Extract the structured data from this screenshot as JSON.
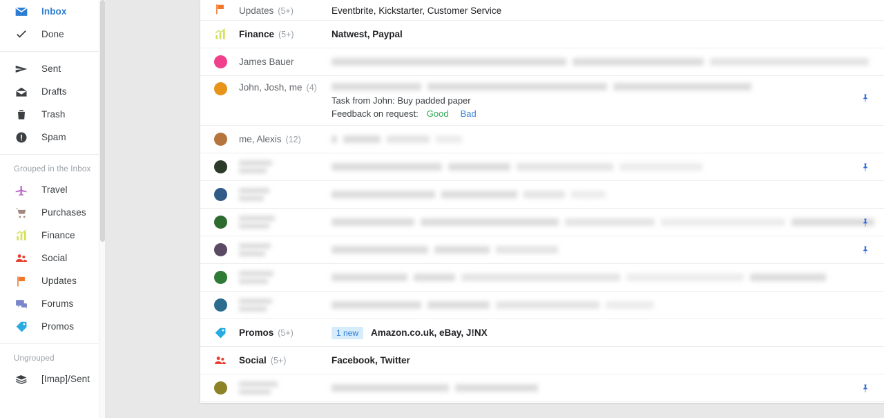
{
  "sidebar": {
    "primary": [
      {
        "label": "Inbox",
        "icon": "inbox-envelope-icon",
        "active": true
      },
      {
        "label": "Done",
        "icon": "check-icon",
        "active": false
      }
    ],
    "system": [
      {
        "label": "Sent",
        "icon": "send-paperplane-icon"
      },
      {
        "label": "Drafts",
        "icon": "draft-envelope-icon"
      },
      {
        "label": "Trash",
        "icon": "trash-icon"
      },
      {
        "label": "Spam",
        "icon": "spam-exclamation-icon"
      }
    ],
    "grouped_title": "Grouped in the Inbox",
    "grouped": [
      {
        "label": "Travel",
        "icon": "airplane-icon",
        "color": "#b968c7"
      },
      {
        "label": "Purchases",
        "icon": "cart-icon",
        "color": "#a1887f"
      },
      {
        "label": "Finance",
        "icon": "bar-chart-icon",
        "color": "#d4e157"
      },
      {
        "label": "Social",
        "icon": "people-icon",
        "color": "#e94235"
      },
      {
        "label": "Updates",
        "icon": "flag-icon",
        "color": "#f4762a"
      },
      {
        "label": "Forums",
        "icon": "forum-icon",
        "color": "#7986cb"
      },
      {
        "label": "Promos",
        "icon": "tag-icon",
        "color": "#29abe2"
      }
    ],
    "ungrouped_title": "Ungrouped",
    "ungrouped": [
      {
        "label": "[Imap]/Sent",
        "icon": "stacked-mail-icon"
      }
    ]
  },
  "list": {
    "rows": [
      {
        "id": "row-updates",
        "kind": "bundle",
        "icon": "flag-icon",
        "icon_color": "#f4762a",
        "name": "Updates",
        "count": "(5+)",
        "bold": false,
        "subject": "Eventbrite, Kickstarter, Customer Service",
        "subject_bold": false,
        "badge": "",
        "pinned": false,
        "clipped": true
      },
      {
        "id": "row-finance",
        "kind": "bundle",
        "icon": "bar-chart-icon",
        "icon_color": "#d4e157",
        "name": "Finance",
        "count": "(5+)",
        "bold": true,
        "subject": "Natwest, Paypal",
        "subject_bold": true,
        "badge": "",
        "pinned": false
      },
      {
        "id": "row-james-bauer",
        "kind": "message",
        "avatar_color": "#f0408c",
        "name": "James Bauer",
        "count": "",
        "bold": false,
        "subject": "",
        "redacted": [
          340,
          190,
          230
        ],
        "pinned": false
      },
      {
        "id": "row-john-josh-me",
        "kind": "task",
        "avatar_color": "#e8941a",
        "name": "John, Josh, me",
        "count": "(4)",
        "bold": false,
        "redacted": [
          130,
          260,
          200
        ],
        "task_text": "Task from John: Buy padded paper",
        "feedback_label": "Feedback on request:",
        "feedback_good": "Good",
        "feedback_bad": "Bad",
        "pinned": true
      },
      {
        "id": "row-me-alexis",
        "kind": "message",
        "avatar_color": "#b5753c",
        "name": "me, Alexis",
        "count": "(12)",
        "bold": false,
        "redacted": [
          8,
          54,
          62,
          38
        ],
        "pinned": false
      },
      {
        "id": "row-redacted-1",
        "kind": "redacted",
        "avatar_color": "#2c3a2a",
        "who_redacted": [
          48,
          40
        ],
        "redacted": [
          160,
          90,
          140,
          120
        ],
        "pinned": true
      },
      {
        "id": "row-redacted-2",
        "kind": "redacted",
        "avatar_color": "#2f5b86",
        "who_redacted": [
          44,
          36
        ],
        "redacted": [
          150,
          110,
          60,
          50
        ],
        "pinned": false
      },
      {
        "id": "row-redacted-3",
        "kind": "redacted",
        "avatar_color": "#2e6b2e",
        "who_redacted": [
          52,
          44
        ],
        "redacted": [
          120,
          200,
          130,
          180,
          120
        ],
        "pinned": true
      },
      {
        "id": "row-redacted-4",
        "kind": "redacted",
        "avatar_color": "#5b4a63",
        "who_redacted": [
          46,
          38
        ],
        "redacted": [
          140,
          80,
          90
        ],
        "pinned": true
      },
      {
        "id": "row-redacted-5",
        "kind": "redacted",
        "avatar_color": "#2f7a35",
        "who_redacted": [
          50,
          42
        ],
        "redacted": [
          110,
          60,
          230,
          170,
          110
        ],
        "pinned": false
      },
      {
        "id": "row-redacted-6",
        "kind": "redacted",
        "avatar_color": "#2b6d8f",
        "who_redacted": [
          48,
          40
        ],
        "redacted": [
          130,
          90,
          150,
          70
        ],
        "pinned": false
      },
      {
        "id": "row-promos",
        "kind": "bundle",
        "icon": "tag-icon",
        "icon_color": "#29abe2",
        "name": "Promos",
        "count": "(5+)",
        "bold": true,
        "badge": "1 new",
        "subject": "Amazon.co.uk, eBay, J!NX",
        "subject_bold": true,
        "pinned": false
      },
      {
        "id": "row-social",
        "kind": "bundle",
        "icon": "people-icon",
        "icon_color": "#e94235",
        "name": "Social",
        "count": "(5+)",
        "bold": true,
        "badge": "",
        "subject": "Facebook, Twitter",
        "subject_bold": true,
        "pinned": false
      },
      {
        "id": "row-redacted-7",
        "kind": "redacted",
        "avatar_color": "#8d8226",
        "who_redacted": [
          56,
          46
        ],
        "redacted": [
          170,
          120
        ],
        "pinned": true
      }
    ]
  },
  "colors": {
    "accent": "#2b7cd3",
    "page_bg": "#e8e8e8",
    "card_bg": "#ffffff",
    "divider": "#ededed",
    "badge_bg": "#d7ecfa",
    "good": "#34a853",
    "bad": "#3b82d6",
    "pin": "#3b6fd4"
  }
}
